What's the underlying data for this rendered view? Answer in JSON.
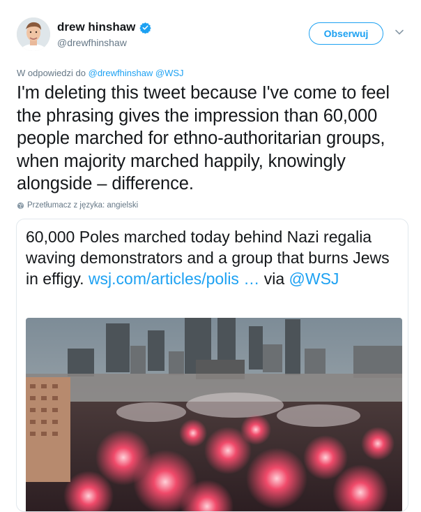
{
  "author": {
    "name": "drew hinshaw",
    "handle": "@drewfhinshaw"
  },
  "follow_label": "Obserwuj",
  "reply": {
    "prefix": "W odpowiedzi do",
    "mentions": "@drewfhinshaw @WSJ"
  },
  "tweet_text": "I'm deleting this tweet because I've come to feel the phrasing gives the impression than 60,000 people marched for ethno-authoritarian groups, when majority marched happily, knowingly alongside – difference.",
  "translate_label": "Przetłumacz z języka: angielski",
  "quoted": {
    "text": "60,000 Poles marched today behind Nazi regalia waving demonstrators and a group that burns Jews in effigy.",
    "link": "wsj.com/articles/polis",
    "ellipsis": "…",
    "via": "via",
    "via_handle": "@WSJ"
  },
  "colors": {
    "accent": "#1da1f2",
    "text": "#14171a",
    "muted": "#657786"
  },
  "icons": [
    "verified-icon",
    "chevron-down-icon",
    "globe-icon"
  ]
}
